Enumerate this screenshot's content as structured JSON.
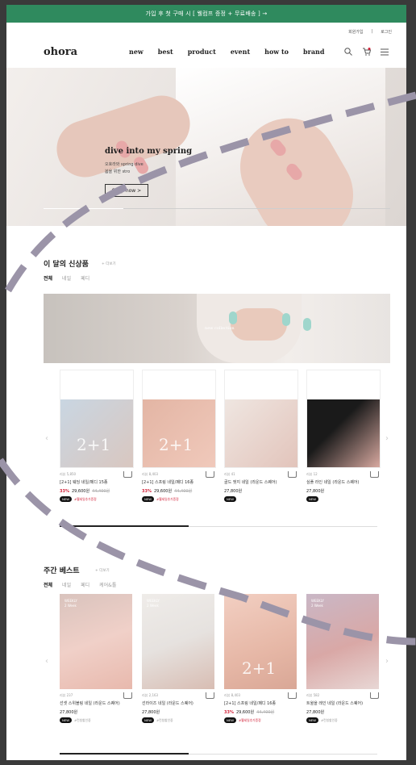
{
  "topbar": {
    "text": "가입 후 첫 구매 시 [ 웰컴프 증정 + 무료배송 ] →"
  },
  "util": {
    "join": "회원가입",
    "login": "로그인"
  },
  "header": {
    "logo": "ohora",
    "nav": [
      "new",
      "best",
      "product",
      "event",
      "how to",
      "brand"
    ]
  },
  "hero": {
    "title": "dive into my spring",
    "sub1": "오호라와 spring dive",
    "sub2": "봄을 위한 stro",
    "button": "Shop now >",
    "progress": 0.23
  },
  "new_section": {
    "title": "이 달의 신상품",
    "more": "+ 더보기",
    "tabs": [
      "전체",
      "네일",
      "페디"
    ],
    "banner_text": "new collection",
    "products": [
      {
        "reviews": "리뷰 5,850",
        "name": "[2+1] 웨딩 네일/페디 15종",
        "discount": "33%",
        "price": "29,600원",
        "original": "44,400원",
        "badge_new": "NEW",
        "badge_tag": "#웰세일추가증정",
        "colors": [
          "#c9d6e2",
          "#d9c7c0"
        ]
      },
      {
        "reviews": "리뷰 8,403",
        "name": "[2+1] 스프링 네일/페디 16종",
        "discount": "33%",
        "price": "29,600원",
        "original": "44,400원",
        "badge_new": "NEW",
        "badge_tag": "#웰세일추가증정",
        "colors": [
          "#e3b5a4",
          "#f0c9bb"
        ]
      },
      {
        "reviews": "리뷰 41",
        "name": "골드 엣지 네일 (라운드 스퀘어)",
        "discount": "",
        "price": "27,800원",
        "original": "",
        "badge_new": "NEW",
        "badge_tag": "",
        "colors": [
          "#efe6e1",
          "#e2c4bb"
        ]
      },
      {
        "reviews": "리뷰 12",
        "name": "심플 라인 네일 (라운드 스퀘어)",
        "discount": "",
        "price": "27,800원",
        "original": "",
        "badge_new": "NEW",
        "badge_tag": "",
        "colors": [
          "#1a1a1a",
          "#d8a9a0"
        ]
      }
    ]
  },
  "best_section": {
    "title": "주간 베스트",
    "more": "+ 더보기",
    "tabs": [
      "전체",
      "네일",
      "페디",
      "케어&툴"
    ],
    "products": [
      {
        "reviews": "리뷰 237",
        "name": "선셋 스위블링 네일 (라운드 스퀘어)",
        "price": "27,800원",
        "badge_new": "NEW",
        "badge_tag": "#런칭할인중",
        "rank": "WEEKLY",
        "rank2": "2 Week",
        "colors": [
          "#f0d0c8",
          "#e8b9ad"
        ]
      },
      {
        "reviews": "리뷰 2,163",
        "name": "선라이즈 네일 (라운드 스퀘어)",
        "price": "27,800원",
        "badge_new": "NEW",
        "badge_tag": "#런칭할인중",
        "rank": "WEEKLY",
        "rank2": "2 Week",
        "colors": [
          "#e6e2df",
          "#d8bdb3"
        ]
      },
      {
        "reviews": "리뷰 8,403",
        "name": "[2+1] 스프링 네일/페디 16종",
        "discount": "33%",
        "price": "29,600원",
        "original": "44,400원",
        "badge_new": "NEW",
        "badge_tag": "#웰세일추가증정",
        "rank": "",
        "rank2": "",
        "colors": [
          "#e6b7a6",
          "#f2cfc2"
        ]
      },
      {
        "reviews": "리뷰 582",
        "name": "트윌을 레인 네일 (라운드 스퀘어)",
        "price": "27,800원",
        "badge_new": "NEW",
        "badge_tag": "#런칭할인중",
        "rank": "WEEKLY",
        "rank2": "2 Week",
        "colors": [
          "#d9a8a6",
          "#c9b7c6"
        ]
      }
    ]
  },
  "colors": {
    "topbar": "#2f8a5e",
    "accent": "#d2233a",
    "overlay_dash": "#9b94a8"
  }
}
